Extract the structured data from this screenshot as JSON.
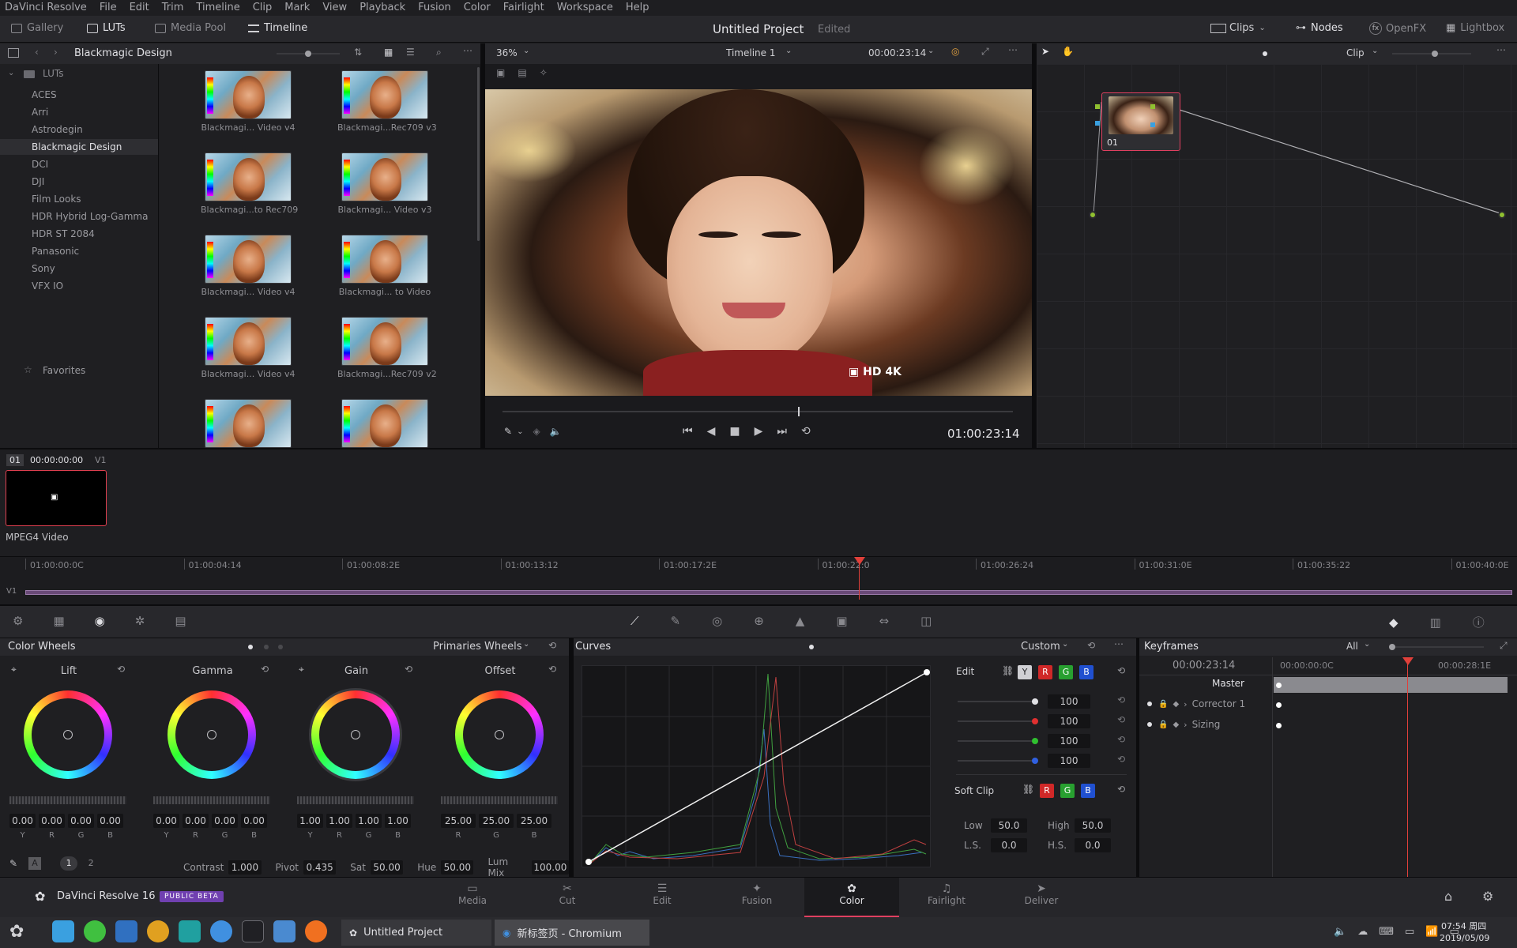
{
  "menubar": {
    "items": [
      "DaVinci Resolve",
      "File",
      "Edit",
      "Trim",
      "Timeline",
      "Clip",
      "Mark",
      "View",
      "Playback",
      "Fusion",
      "Color",
      "Fairlight",
      "Workspace",
      "Help"
    ]
  },
  "toolbar": {
    "gallery": "Gallery",
    "luts": "LUTs",
    "media_pool": "Media Pool",
    "timeline": "Timeline",
    "project_title": "Untitled Project",
    "project_status": "Edited",
    "clips": "Clips",
    "nodes": "Nodes",
    "openfx": "OpenFX",
    "lightbox": "Lightbox"
  },
  "lut_browser": {
    "title": "Blackmagic Design",
    "tree_root": "LUTs",
    "tree": [
      "ACES",
      "Arri",
      "Astrodegin",
      "Blackmagic Design",
      "DCI",
      "DJI",
      "Film Looks",
      "HDR Hybrid Log-Gamma",
      "HDR ST 2084",
      "Panasonic",
      "Sony",
      "VFX IO"
    ],
    "favorites": "Favorites",
    "thumbs": [
      "Blackmagi... Video v4",
      "Blackmagi...Rec709 v3",
      "Blackmagi...to Rec709",
      "Blackmagi... Video v3",
      "Blackmagi... Video v4",
      "Blackmagi... to Video",
      "Blackmagi... Video v4",
      "Blackmagi...Rec709 v2",
      "",
      ""
    ]
  },
  "viewer": {
    "zoom": "36%",
    "timeline_name": "Timeline 1",
    "timecode_top": "00:00:23:14",
    "timecode": "01:00:23:14"
  },
  "node_editor": {
    "clip_mode": "Clip",
    "node_label": "01"
  },
  "clip_strip": {
    "index": "01",
    "timecode": "00:00:00:00",
    "track": "V1",
    "codec": "MPEG4 Video",
    "ruler": [
      "01:00:00:0C",
      "01:00:04:14",
      "01:00:08:2E",
      "01:00:13:12",
      "01:00:17:2E",
      "01:00:22:0",
      "01:00:26:24",
      "01:00:31:0E",
      "01:00:35:22",
      "01:00:40:0E"
    ],
    "track_label": "V1"
  },
  "color_wheels": {
    "title": "Color Wheels",
    "mode": "Primaries Wheels",
    "wheels": [
      {
        "name": "Lift",
        "values": [
          "0.00",
          "0.00",
          "0.00",
          "0.00"
        ],
        "labels": [
          "Y",
          "R",
          "G",
          "B"
        ]
      },
      {
        "name": "Gamma",
        "values": [
          "0.00",
          "0.00",
          "0.00",
          "0.00"
        ],
        "labels": [
          "Y",
          "R",
          "G",
          "B"
        ]
      },
      {
        "name": "Gain",
        "values": [
          "1.00",
          "1.00",
          "1.00",
          "1.00"
        ],
        "labels": [
          "Y",
          "R",
          "G",
          "B"
        ]
      },
      {
        "name": "Offset",
        "values": [
          "25.00",
          "25.00",
          "25.00"
        ],
        "labels": [
          "R",
          "G",
          "B"
        ]
      }
    ],
    "page1": "1",
    "page2": "2",
    "contrast_label": "Contrast",
    "contrast": "1.000",
    "pivot_label": "Pivot",
    "pivot": "0.435",
    "sat_label": "Sat",
    "sat": "50.00",
    "hue_label": "Hue",
    "hue": "50.00",
    "lummix_label": "Lum Mix",
    "lummix": "100.00"
  },
  "curves": {
    "title": "Curves",
    "mode": "Custom",
    "edit_label": "Edit",
    "channels": [
      "Y",
      "R",
      "G",
      "B"
    ],
    "intensities": [
      "100",
      "100",
      "100",
      "100"
    ],
    "softclip_label": "Soft Clip",
    "low_label": "Low",
    "low": "50.0",
    "high_label": "High",
    "high": "50.0",
    "ls_label": "L.S.",
    "ls": "0.0",
    "hs_label": "H.S.",
    "hs": "0.0"
  },
  "keyframes": {
    "title": "Keyframes",
    "filter": "All",
    "timecode": "00:00:23:14",
    "ruler_start": "00:00:00:0C",
    "ruler_end": "00:00:28:1E",
    "tracks": [
      "Master",
      "Corrector 1",
      "Sizing"
    ]
  },
  "footer": {
    "app_name": "DaVinci Resolve 16",
    "badge": "PUBLIC BETA",
    "tabs": [
      "Media",
      "Cut",
      "Edit",
      "Fusion",
      "Color",
      "Fairlight",
      "Deliver"
    ],
    "active_tab": "Color"
  },
  "taskbar": {
    "window1": "Untitled Project",
    "window2": "新标签页 - Chromium",
    "time": "07:54 周四",
    "date": "2019/05/09"
  },
  "colors": {
    "accent_red": "#e0403a",
    "active_tab": "#e04060",
    "bg": "#1c1c1f"
  }
}
